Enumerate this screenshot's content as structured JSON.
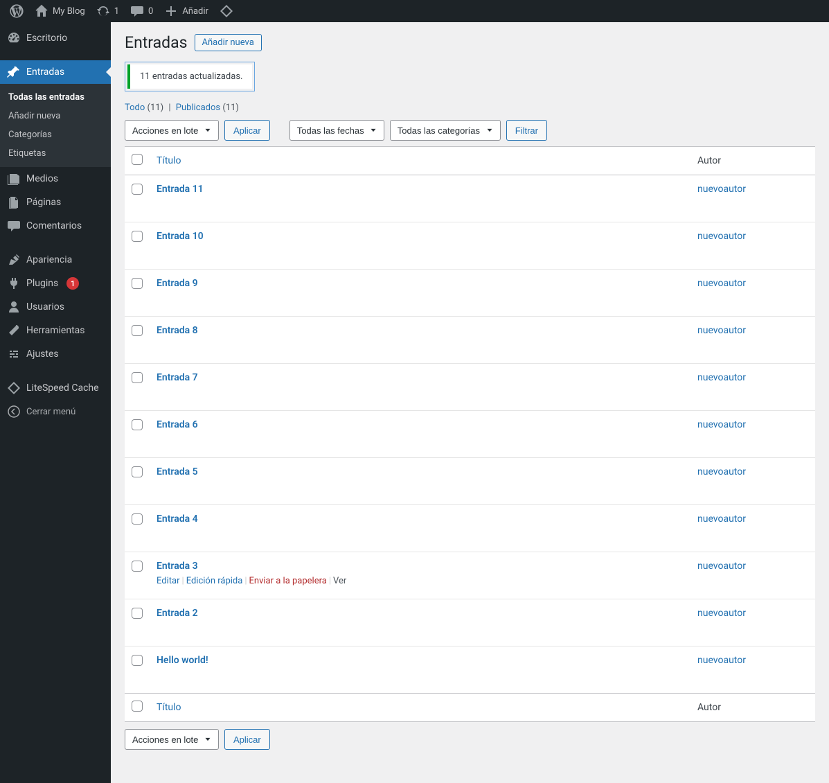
{
  "topbar": {
    "site_name": "My Blog",
    "updates_count": "1",
    "comments_count": "0",
    "new_label": "Añadir"
  },
  "sidebar": {
    "dashboard": "Escritorio",
    "posts": "Entradas",
    "posts_sub": {
      "all": "Todas las entradas",
      "add": "Añadir nueva",
      "categories": "Categorías",
      "tags": "Etiquetas"
    },
    "media": "Medios",
    "pages": "Páginas",
    "comments": "Comentarios",
    "appearance": "Apariencia",
    "plugins": "Plugins",
    "plugins_badge": "1",
    "users": "Usuarios",
    "tools": "Herramientas",
    "settings": "Ajustes",
    "litespeed": "LiteSpeed Cache",
    "collapse": "Cerrar menú"
  },
  "page": {
    "title": "Entradas",
    "add_new": "Añadir nueva",
    "notice": "11 entradas actualizadas."
  },
  "views": {
    "all_label": "Todo",
    "all_count": "(11)",
    "published_label": "Publicados",
    "published_count": "(11)"
  },
  "filters": {
    "bulk_label": "Acciones en lote",
    "apply": "Aplicar",
    "all_dates": "Todas las fechas",
    "all_categories": "Todas las categorías",
    "filter": "Filtrar"
  },
  "table": {
    "col_title": "Título",
    "col_author": "Autor",
    "rows": [
      {
        "title": "Entrada 11",
        "author": "nuevoautor"
      },
      {
        "title": "Entrada 10",
        "author": "nuevoautor"
      },
      {
        "title": "Entrada 9",
        "author": "nuevoautor"
      },
      {
        "title": "Entrada 8",
        "author": "nuevoautor"
      },
      {
        "title": "Entrada 7",
        "author": "nuevoautor"
      },
      {
        "title": "Entrada 6",
        "author": "nuevoautor"
      },
      {
        "title": "Entrada 5",
        "author": "nuevoautor"
      },
      {
        "title": "Entrada 4",
        "author": "nuevoautor"
      },
      {
        "title": "Entrada 3",
        "author": "nuevoautor",
        "show_actions": true
      },
      {
        "title": "Entrada 2",
        "author": "nuevoautor"
      },
      {
        "title": "Hello world!",
        "author": "nuevoautor"
      }
    ]
  },
  "row_actions": {
    "edit": "Editar",
    "quick_edit": "Edición rápida",
    "trash": "Enviar a la papelera",
    "view": "Ver"
  }
}
